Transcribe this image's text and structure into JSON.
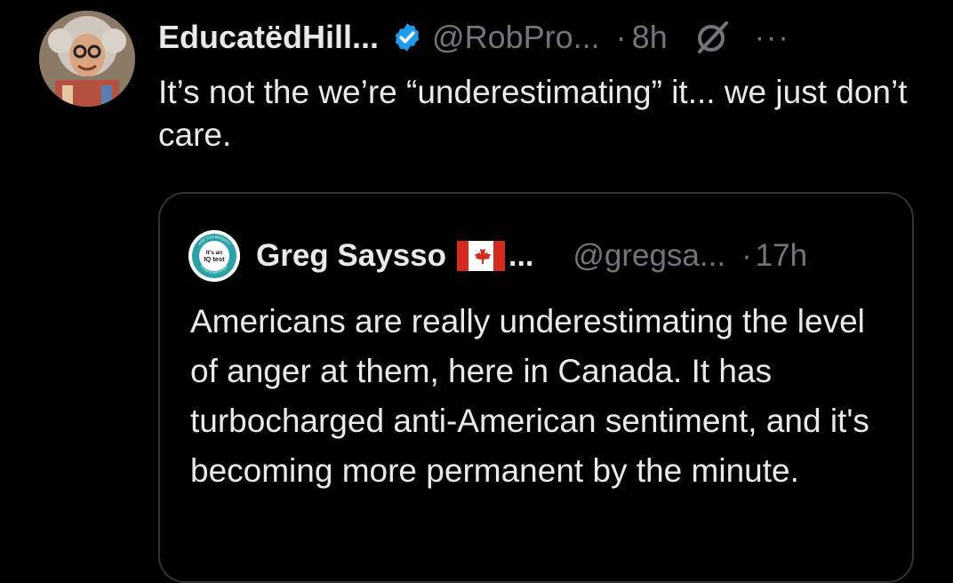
{
  "tweet": {
    "author": {
      "display_name": "EducatëdHill...",
      "handle": "@RobPro...",
      "verified": true
    },
    "separator": "·",
    "time": "8h",
    "more_label": "···",
    "text": "It’s not the we’re “underestimating” it... we just don’t care."
  },
  "quoted_tweet": {
    "author": {
      "display_name": "Greg Saysso",
      "name_suffix": "...",
      "handle": "@gregsa...",
      "avatar_badge": {
        "line1": "It's an",
        "line2": "IQ test",
        "ring_top": "ARE YOU BRIGHT?",
        "ring_bottom": "COVID IS NOT A TEST"
      }
    },
    "separator": "·",
    "time": "17h",
    "text": "Americans are really underestimating the level of anger at them, here in Canada. It has turbocharged anti-American sentiment, and it's becoming more permanent by the minute."
  },
  "icons": {
    "verified": "verified-badge-icon",
    "grok": "grok-icon",
    "more": "more-icon",
    "flag": "canada-flag-icon"
  },
  "colors": {
    "background": "#000000",
    "text": "#e7e9ea",
    "muted": "#71767b",
    "verified_blue": "#1d9bf0",
    "border": "#2f3336",
    "flag_red": "#d52b1e"
  }
}
